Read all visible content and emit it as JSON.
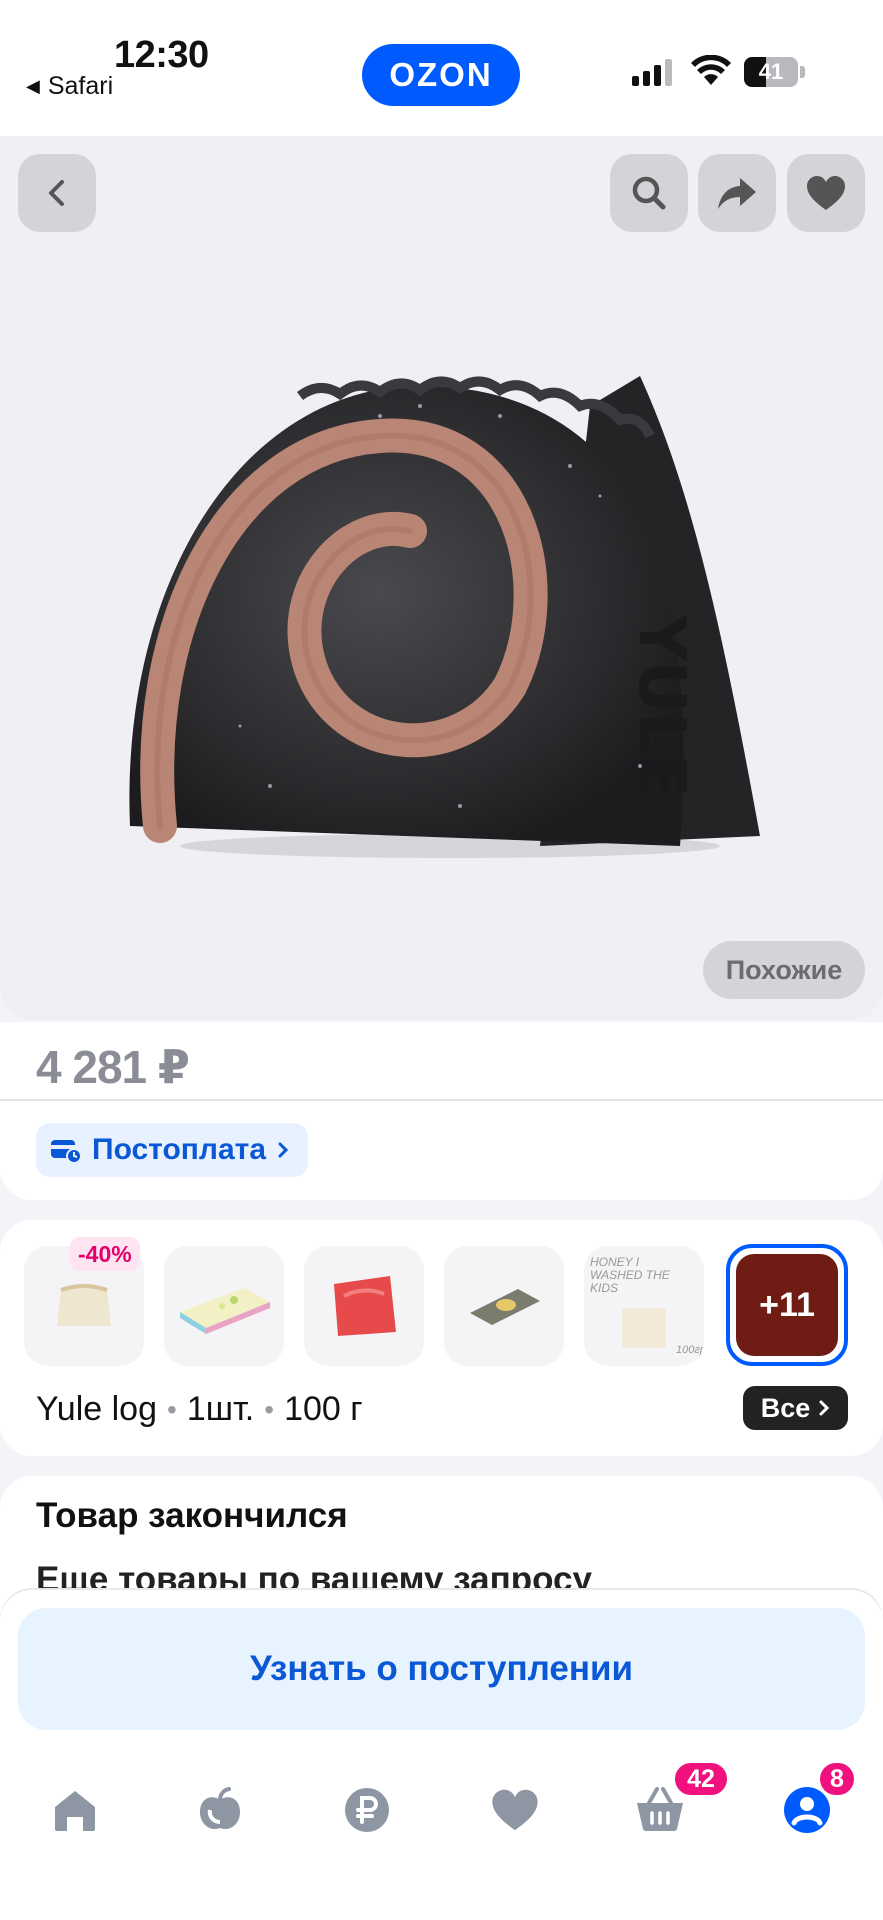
{
  "status_bar": {
    "time": "12:30",
    "back_app": "Safari",
    "battery": "41"
  },
  "header": {
    "logo": "OZON"
  },
  "gallery": {
    "similar_label": "Похожие",
    "product_text": "YULE"
  },
  "price": {
    "value": "4 281 ₽",
    "postpay_label": "Постоплата"
  },
  "variants": {
    "discount": "-40%",
    "more_label": "+11",
    "thumb_text": "HONEY I WASHED THE KIDS",
    "thumb_weight": "100гр",
    "name": "Yule log",
    "quantity": "1шт.",
    "weight": "100 г",
    "all_label": "Все"
  },
  "stock": {
    "title": "Товар закончился",
    "subtitle": "Еще товары по вашему запросу"
  },
  "actions": {
    "notify_label": "Узнать о поступлении"
  },
  "tabbar": {
    "cart_badge": "42",
    "profile_badge": "8"
  },
  "colors": {
    "accent": "#005bff",
    "badge": "#f1117e",
    "text_blue": "#0a58d6"
  }
}
